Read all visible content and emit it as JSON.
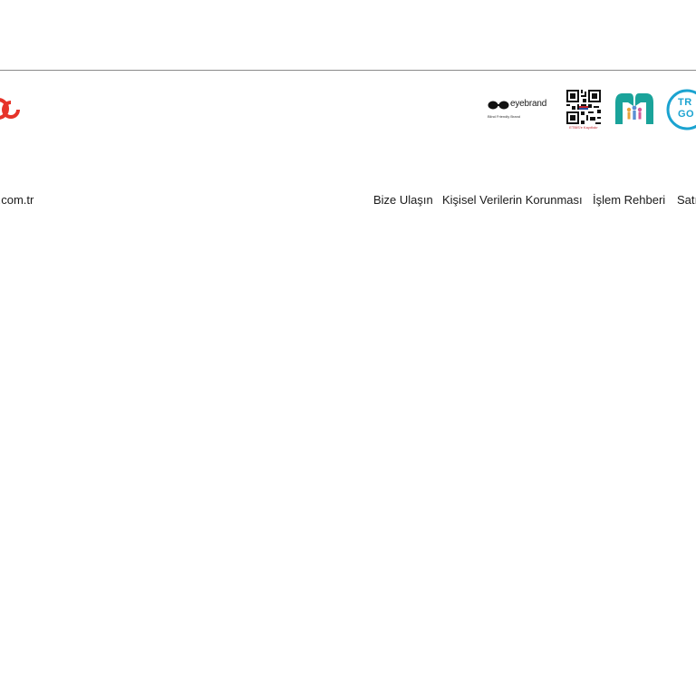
{
  "header": {
    "partners": {
      "eyebrand": {
        "name": "eyebrand",
        "subtitle": "Blind Friendly Brand"
      },
      "etbis": {
        "label": "ETBİS'e Kayıtlıdır"
      },
      "hands_logo": {
        "icon": "hands-family-icon"
      },
      "trgo": {
        "line1": "TR",
        "line2": "GO"
      }
    },
    "brand_color": "#e63329",
    "accent_teal": "#1aa39a",
    "accent_blue": "#1ba3d0"
  },
  "footer": {
    "domain_text": "t.com.tr",
    "links": [
      {
        "label": "Bize Ulaşın"
      },
      {
        "label": "Kişisel Verilerin Korunması"
      },
      {
        "label": "İşlem Rehberi"
      },
      {
        "label": "Satı"
      }
    ]
  }
}
